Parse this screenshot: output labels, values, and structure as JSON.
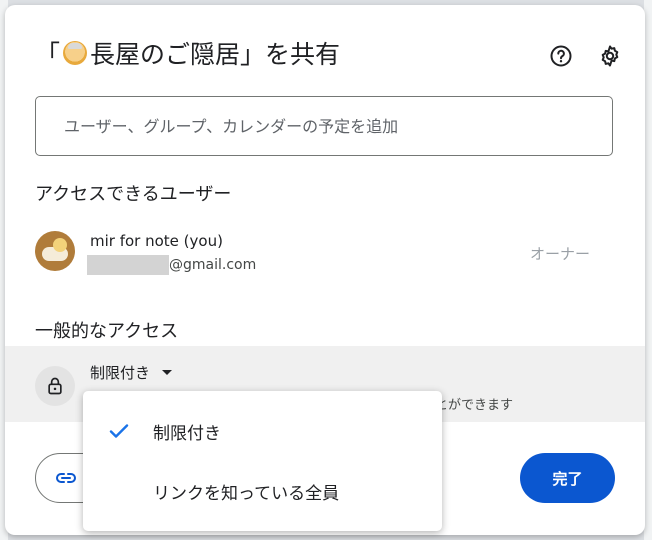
{
  "dialog": {
    "title_open": "「",
    "title_name": "長屋のご隠居",
    "title_close": "」を共有",
    "title_emoji_icon": "elderly-person-emoji-icon"
  },
  "header_icons": {
    "help": "help-circle-icon",
    "settings": "gear-icon"
  },
  "search": {
    "placeholder": "ユーザー、グループ、カレンダーの予定を追加"
  },
  "users_section": {
    "heading": "アクセスできるユーザー",
    "users": [
      {
        "name": "mir for note (you)",
        "email_suffix": "@gmail.com",
        "role": "オーナー"
      }
    ]
  },
  "general_access": {
    "heading": "一般的なアクセス",
    "selected": "制限付き",
    "description_partial": "とができます"
  },
  "dropdown": {
    "options": [
      {
        "label": "制限付き",
        "checked": true
      },
      {
        "label": "リンクを知っている全員",
        "checked": false
      }
    ]
  },
  "footer": {
    "done_label": "完了"
  },
  "colors": {
    "accent": "#0b57d0",
    "check": "#1a73e8",
    "text": "#202124",
    "muted": "#9aa0a6"
  }
}
